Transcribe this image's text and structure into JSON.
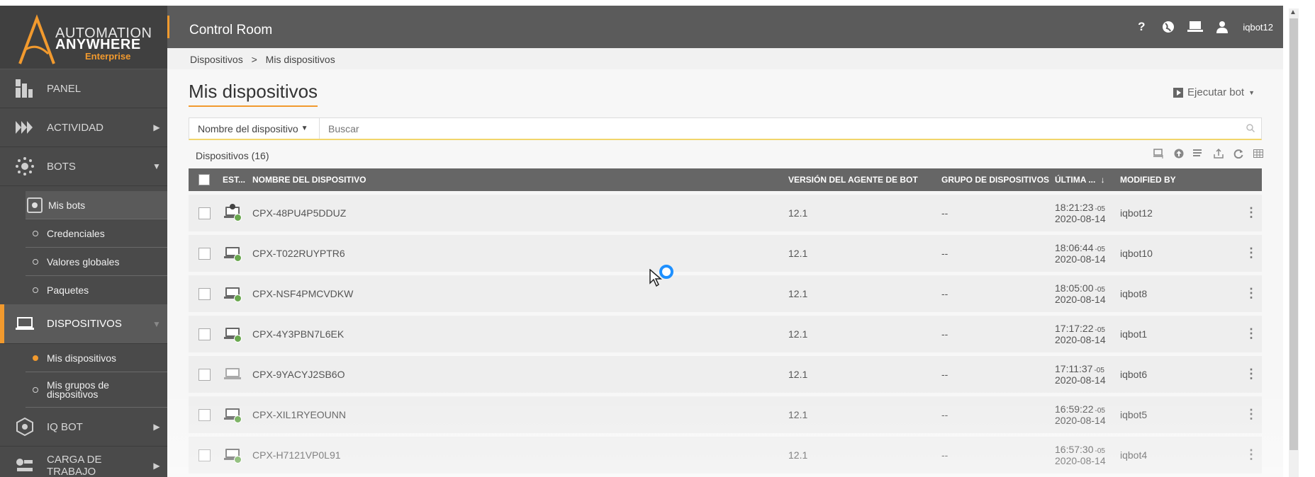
{
  "brand": {
    "line1": "AUTOMATION",
    "line2": "ANYWHERE",
    "edition": "Enterprise",
    "accent_color": "#f29a2e"
  },
  "sidebar": {
    "items": [
      {
        "label": "PANEL",
        "icon": "dashboard-icon"
      },
      {
        "label": "ACTIVIDAD",
        "icon": "activity-icon"
      },
      {
        "label": "BOTS",
        "icon": "bots-icon"
      },
      {
        "label": "DISPOSITIVOS",
        "icon": "devices-icon"
      },
      {
        "label": "IQ BOT",
        "icon": "iqbot-icon"
      },
      {
        "label": "CARGA DE TRABAJO",
        "icon": "workload-icon"
      }
    ],
    "bots_sub": [
      "Mis bots",
      "Credenciales",
      "Valores globales",
      "Paquetes"
    ],
    "devices_sub": [
      "Mis dispositivos",
      "Mis grupos de dispositivos"
    ]
  },
  "header": {
    "title": "Control Room",
    "help_glyph": "?",
    "user": "iqbot12"
  },
  "breadcrumb": {
    "parent": "Dispositivos",
    "separator": ">",
    "current": "Mis dispositivos"
  },
  "main": {
    "page_title": "Mis dispositivos",
    "run_bot_label": "Ejecutar bot",
    "filter_select": "Nombre del dispositivo",
    "search_placeholder": "Buscar",
    "count_label": "Dispositivos (16)"
  },
  "table": {
    "headers": {
      "status": "EST...",
      "name": "NOMBRE DEL DISPOSITIVO",
      "version": "VERSIÓN DEL AGENTE DE BOT",
      "group": "GRUPO DE DISPOSITIVOS",
      "last": "ÚLTIMA ...",
      "modified": "MODIFIED BY"
    },
    "sort_arrow": "↓",
    "rows": [
      {
        "name": "CPX-48PU4P5DDUZ",
        "version": "12.1",
        "group": "--",
        "time": "18:21:23",
        "tz": "-05",
        "date": "2020-08-14",
        "modified_by": "iqbot12",
        "status": "busy"
      },
      {
        "name": "CPX-T022RUYPTR6",
        "version": "12.1",
        "group": "--",
        "time": "18:06:44",
        "tz": "-05",
        "date": "2020-08-14",
        "modified_by": "iqbot10",
        "status": "connected"
      },
      {
        "name": "CPX-NSF4PMCVDKW",
        "version": "12.1",
        "group": "--",
        "time": "18:05:00",
        "tz": "-05",
        "date": "2020-08-14",
        "modified_by": "iqbot8",
        "status": "connected"
      },
      {
        "name": "CPX-4Y3PBN7L6EK",
        "version": "12.1",
        "group": "--",
        "time": "17:17:22",
        "tz": "-05",
        "date": "2020-08-14",
        "modified_by": "iqbot1",
        "status": "connected"
      },
      {
        "name": "CPX-9YACYJ2SB6O",
        "version": "12.1",
        "group": "--",
        "time": "17:11:37",
        "tz": "-05",
        "date": "2020-08-14",
        "modified_by": "iqbot6",
        "status": "offline"
      },
      {
        "name": "CPX-XIL1RYEOUNN",
        "version": "12.1",
        "group": "--",
        "time": "16:59:22",
        "tz": "-05",
        "date": "2020-08-14",
        "modified_by": "iqbot5",
        "status": "connected"
      },
      {
        "name": "CPX-H7121VP0L91",
        "version": "12.1",
        "group": "--",
        "time": "16:57:30",
        "tz": "-05",
        "date": "2020-08-14",
        "modified_by": "iqbot4",
        "status": "connected"
      }
    ]
  }
}
